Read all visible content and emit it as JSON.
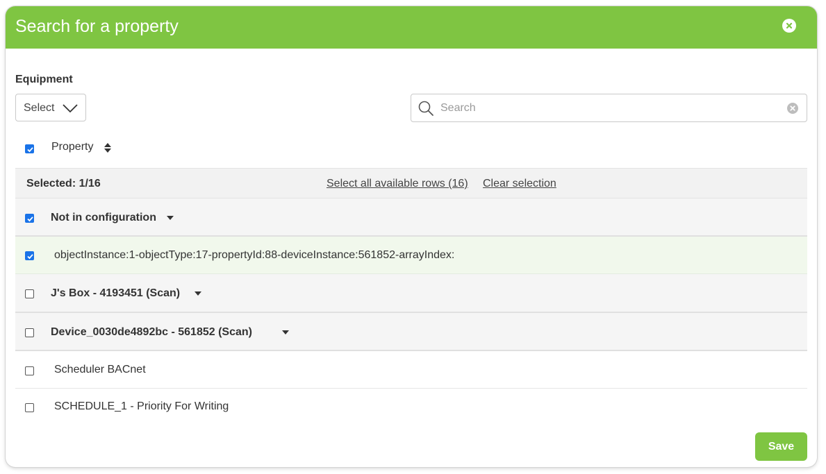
{
  "modal": {
    "title": "Search for a property"
  },
  "filters": {
    "equipment_label": "Equipment",
    "select_label": "Select",
    "search_placeholder": "Search",
    "search_value": ""
  },
  "table": {
    "column_header": "Property",
    "selection_bar": {
      "selected_text": "Selected: 1/16",
      "select_all_link": "Select all available rows (16)",
      "clear_link": "Clear selection"
    },
    "rows": [
      {
        "type": "group",
        "label": "Not in configuration",
        "checked": true
      },
      {
        "type": "item",
        "label": "objectInstance:1-objectType:17-propertyId:88-deviceInstance:561852-arrayIndex:",
        "checked": true
      },
      {
        "type": "group",
        "label": "J's Box - 4193451 (Scan)",
        "checked": false
      },
      {
        "type": "group",
        "label": "Device_0030de4892bc - 561852 (Scan)",
        "checked": false
      },
      {
        "type": "item",
        "label": "Scheduler BACnet",
        "checked": false
      },
      {
        "type": "item",
        "label": "SCHEDULE_1 - Priority For Writing",
        "checked": false
      }
    ]
  },
  "footer": {
    "save_label": "Save"
  },
  "colors": {
    "header_green": "#7fc542",
    "checkbox_blue": "#1a73e8",
    "selected_row": "#f1f8ec"
  }
}
